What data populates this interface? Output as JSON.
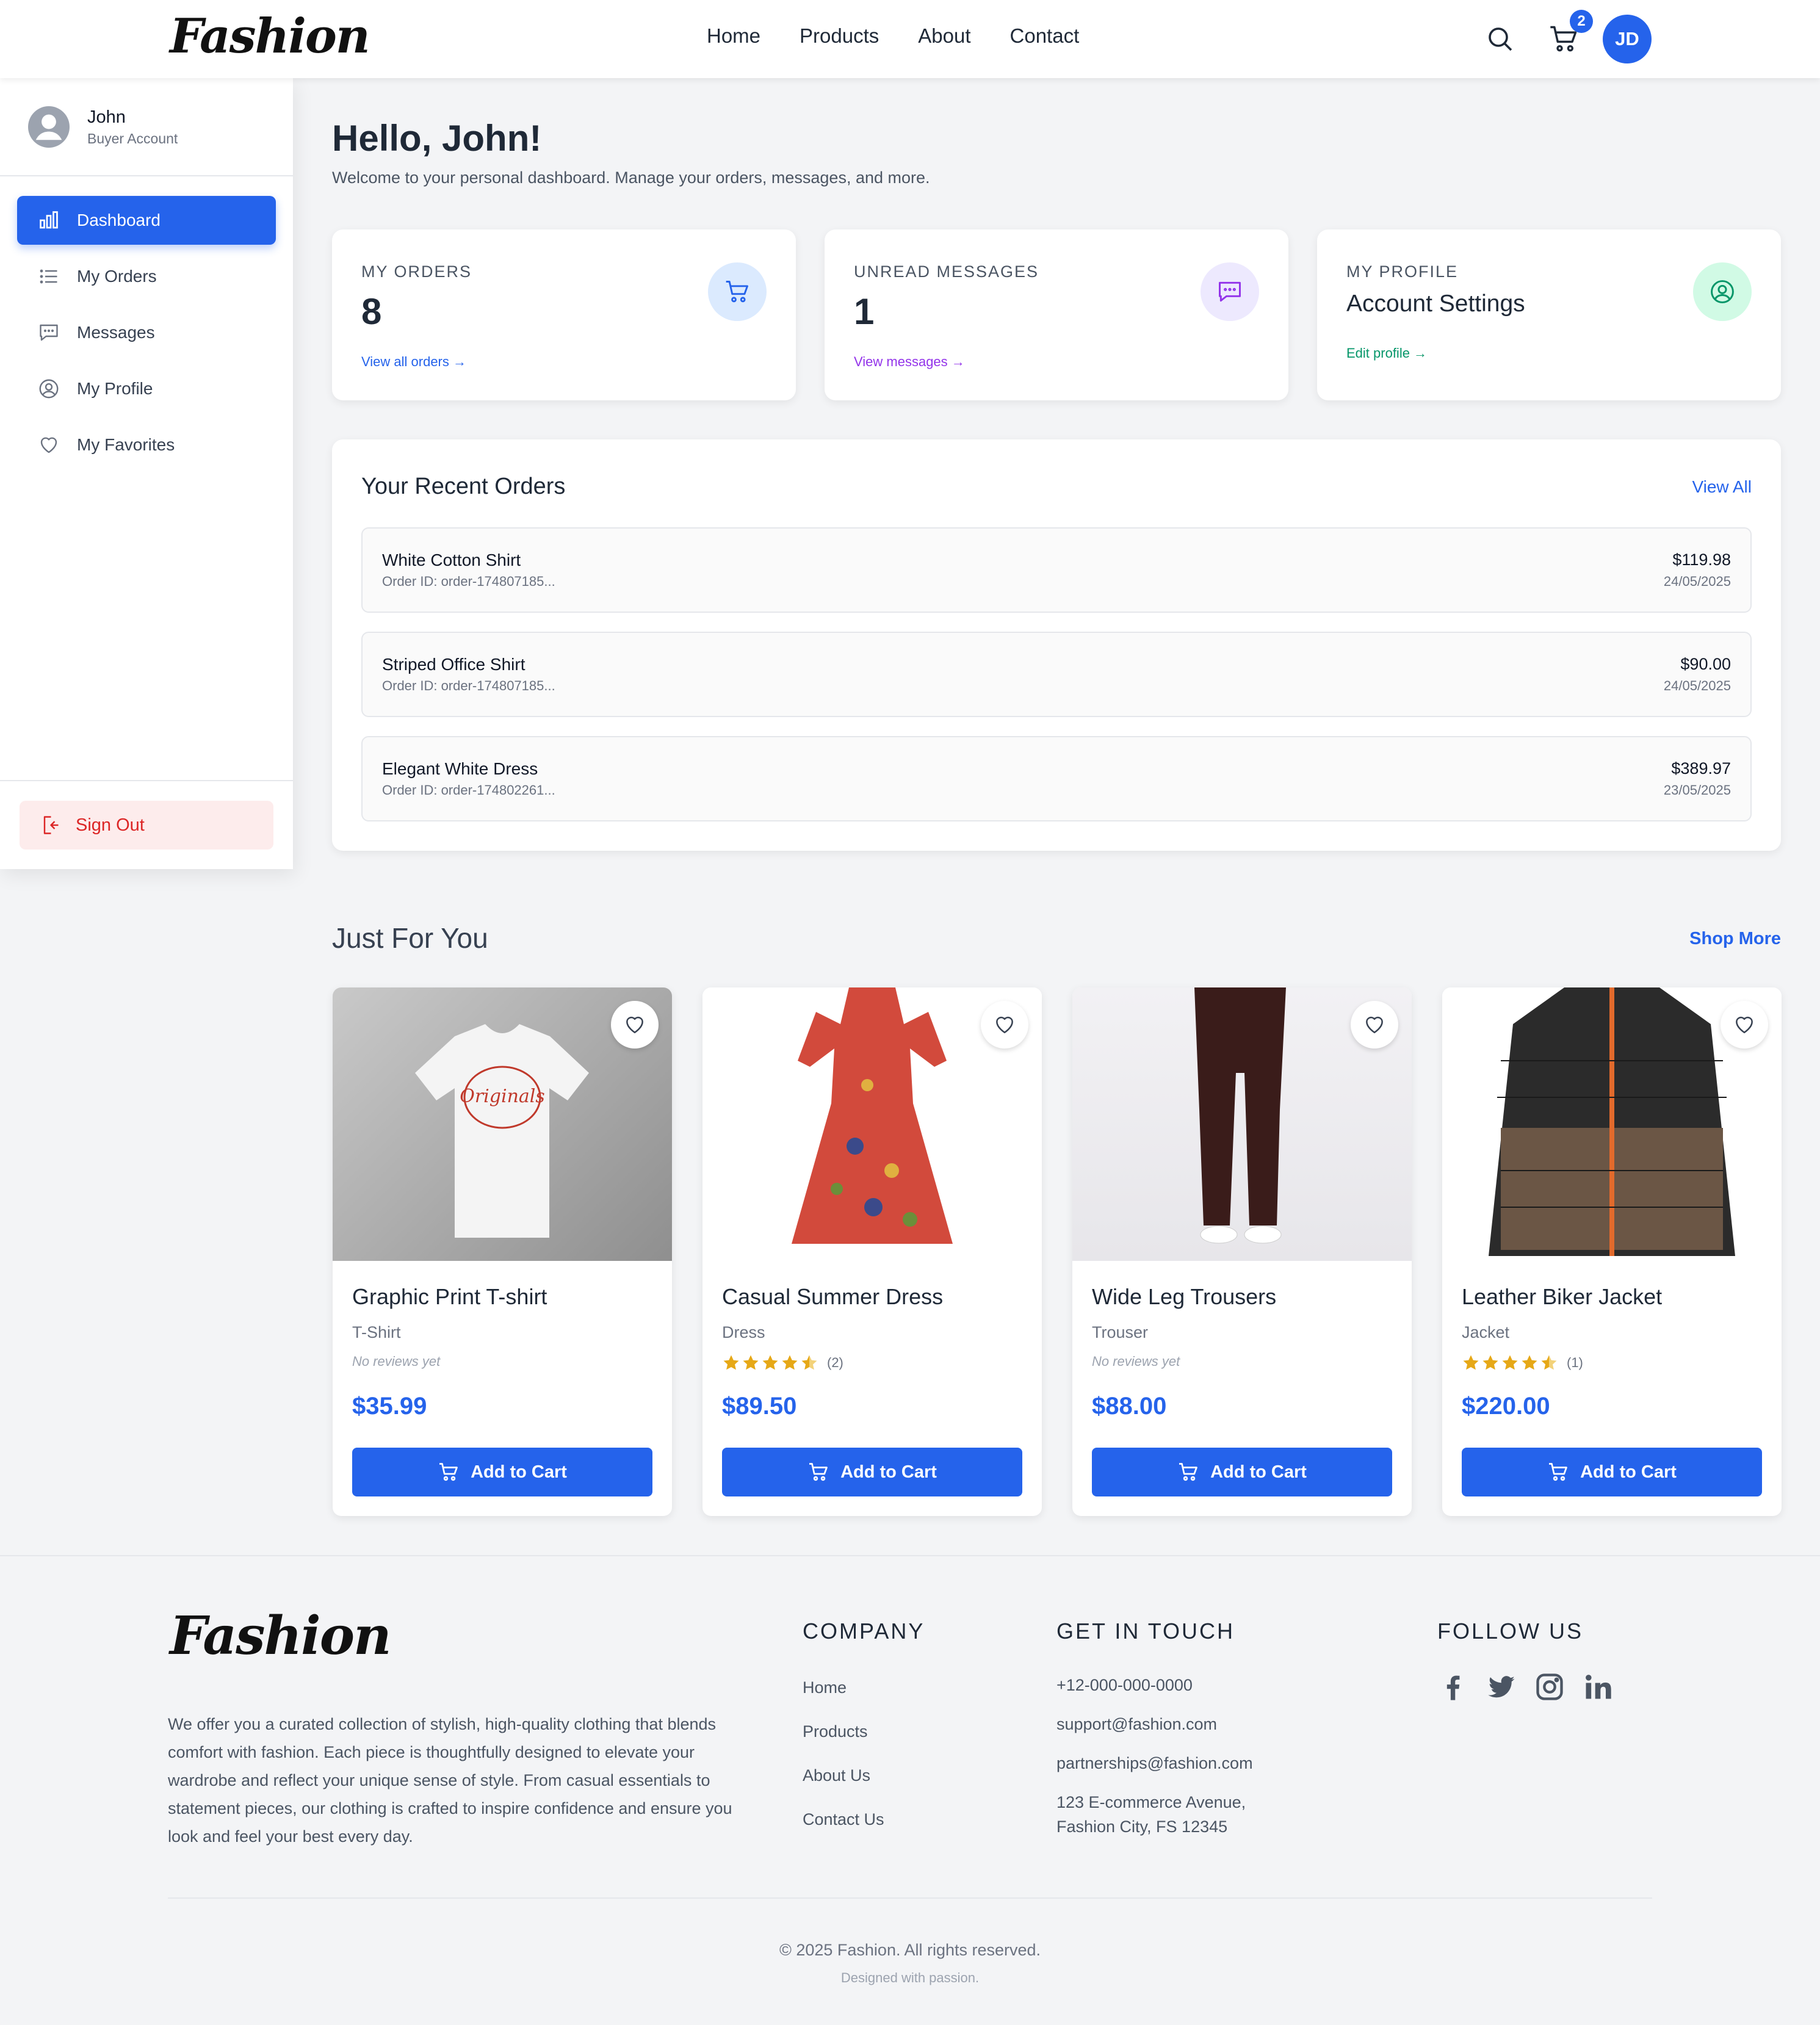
{
  "brand": {
    "logo_text": "Fashion",
    "accent_color": "#2563eb"
  },
  "header": {
    "nav": [
      "Home",
      "Products",
      "About",
      "Contact"
    ],
    "cart_count": "2",
    "avatar_initials": "JD"
  },
  "sidebar": {
    "user_name": "John",
    "user_role": "Buyer Account",
    "items": [
      {
        "label": "Dashboard",
        "icon": "chart-bar-icon",
        "active": true
      },
      {
        "label": "My Orders",
        "icon": "list-icon"
      },
      {
        "label": "Messages",
        "icon": "chat-icon"
      },
      {
        "label": "My Profile",
        "icon": "user-circle-icon"
      },
      {
        "label": "My Favorites",
        "icon": "heart-icon"
      }
    ],
    "sign_out": "Sign Out"
  },
  "main": {
    "greeting": "Hello, John!",
    "welcome": "Welcome to your personal dashboard. Manage your orders, messages, and more.",
    "stats": [
      {
        "label": "MY ORDERS",
        "value": "8",
        "link": "View all orders →",
        "color": "#2563eb",
        "icon": "cart-icon"
      },
      {
        "label": "UNREAD MESSAGES",
        "value": "1",
        "link": "View messages →",
        "color": "#9333ea",
        "icon": "chat-icon"
      },
      {
        "label": "MY PROFILE",
        "value": "Account Settings",
        "link": "Edit profile →",
        "color": "#059669",
        "icon": "user-circle-icon"
      }
    ],
    "recent_orders": {
      "title": "Your Recent Orders",
      "view_all": "View All",
      "rows": [
        {
          "name": "White Cotton Shirt",
          "order_id": "Order ID: order-174807185...",
          "price": "$119.98",
          "date": "24/05/2025"
        },
        {
          "name": "Striped Office Shirt",
          "order_id": "Order ID: order-174807185...",
          "price": "$90.00",
          "date": "24/05/2025"
        },
        {
          "name": "Elegant White Dress",
          "order_id": "Order ID: order-174802261...",
          "price": "$389.97",
          "date": "23/05/2025"
        }
      ]
    },
    "just_for_you": {
      "title": "Just For You",
      "shop_more": "Shop More",
      "add_to_cart": "Add to Cart",
      "products": [
        {
          "name": "Graphic Print T-shirt",
          "category": "T-Shirt",
          "rating_text": "No reviews yet",
          "price": "$35.99"
        },
        {
          "name": "Casual Summer Dress",
          "category": "Dress",
          "rating": 4.5,
          "reviews": "(2)",
          "price": "$89.50"
        },
        {
          "name": "Wide Leg Trousers",
          "category": "Trouser",
          "rating_text": "No reviews yet",
          "price": "$88.00"
        },
        {
          "name": "Leather Biker Jacket",
          "category": "Jacket",
          "rating": 4.5,
          "reviews": "(1)",
          "price": "$220.00"
        }
      ]
    }
  },
  "footer": {
    "description": "We offer you a curated collection of stylish, high-quality clothing that blends comfort with fashion. Each piece is thoughtfully designed to elevate your wardrobe and reflect your unique sense of style. From casual essentials to statement pieces, our clothing is crafted to inspire confidence and ensure you look and feel your best every day.",
    "company_heading": "COMPANY",
    "company_links": [
      "Home",
      "Products",
      "About Us",
      "Contact Us"
    ],
    "contact_heading": "GET IN TOUCH",
    "phone": "+12-000-000-0000",
    "support_email": "support@fashion.com",
    "partner_email": "partnerships@fashion.com",
    "address_line1": "123 E-commerce Avenue,",
    "address_line2": "Fashion City, FS 12345",
    "follow_heading": "FOLLOW US",
    "social": [
      "facebook-icon",
      "twitter-icon",
      "instagram-icon",
      "linkedin-icon"
    ],
    "copyright": "© 2025 Fashion. All rights reserved.",
    "designed": "Designed with passion."
  }
}
